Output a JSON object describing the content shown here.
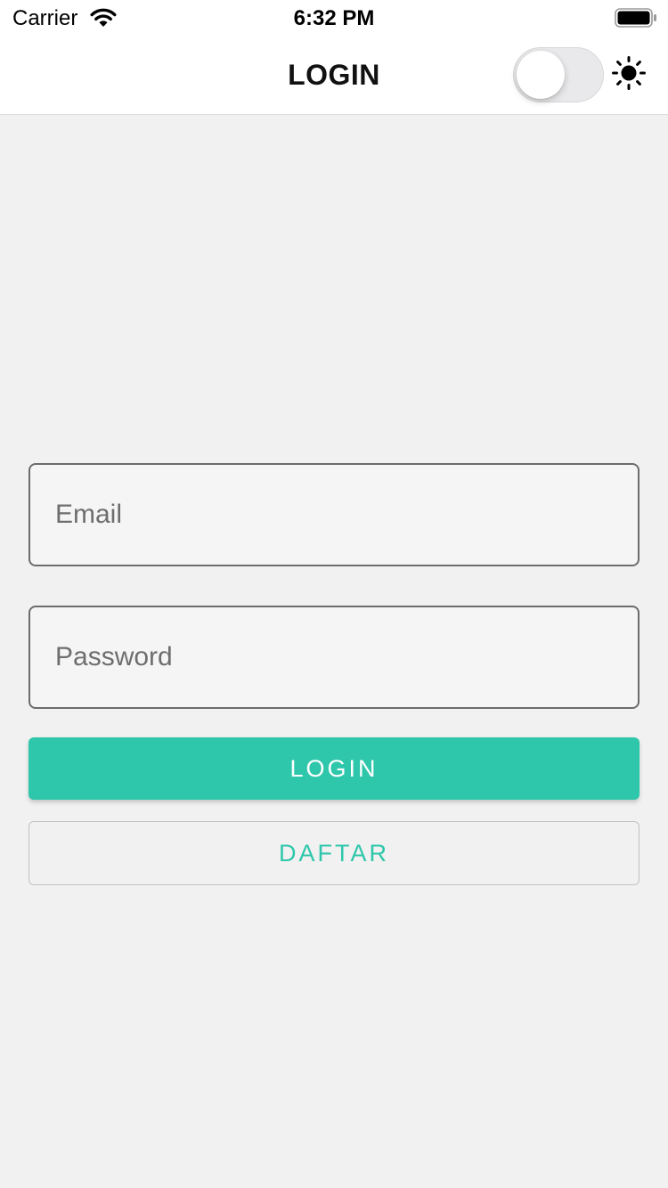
{
  "status_bar": {
    "carrier": "Carrier",
    "time": "6:32 PM"
  },
  "header": {
    "title": "LOGIN",
    "theme_toggle_on": false,
    "theme_icon": "sun-icon"
  },
  "form": {
    "email": {
      "value": "",
      "placeholder": "Email"
    },
    "password": {
      "value": "",
      "placeholder": "Password"
    },
    "login_label": "LOGIN",
    "register_label": "DAFTAR"
  },
  "colors": {
    "accent": "#2ec7ab",
    "background": "#f1f1f1",
    "field_border": "#6c6c6c"
  }
}
